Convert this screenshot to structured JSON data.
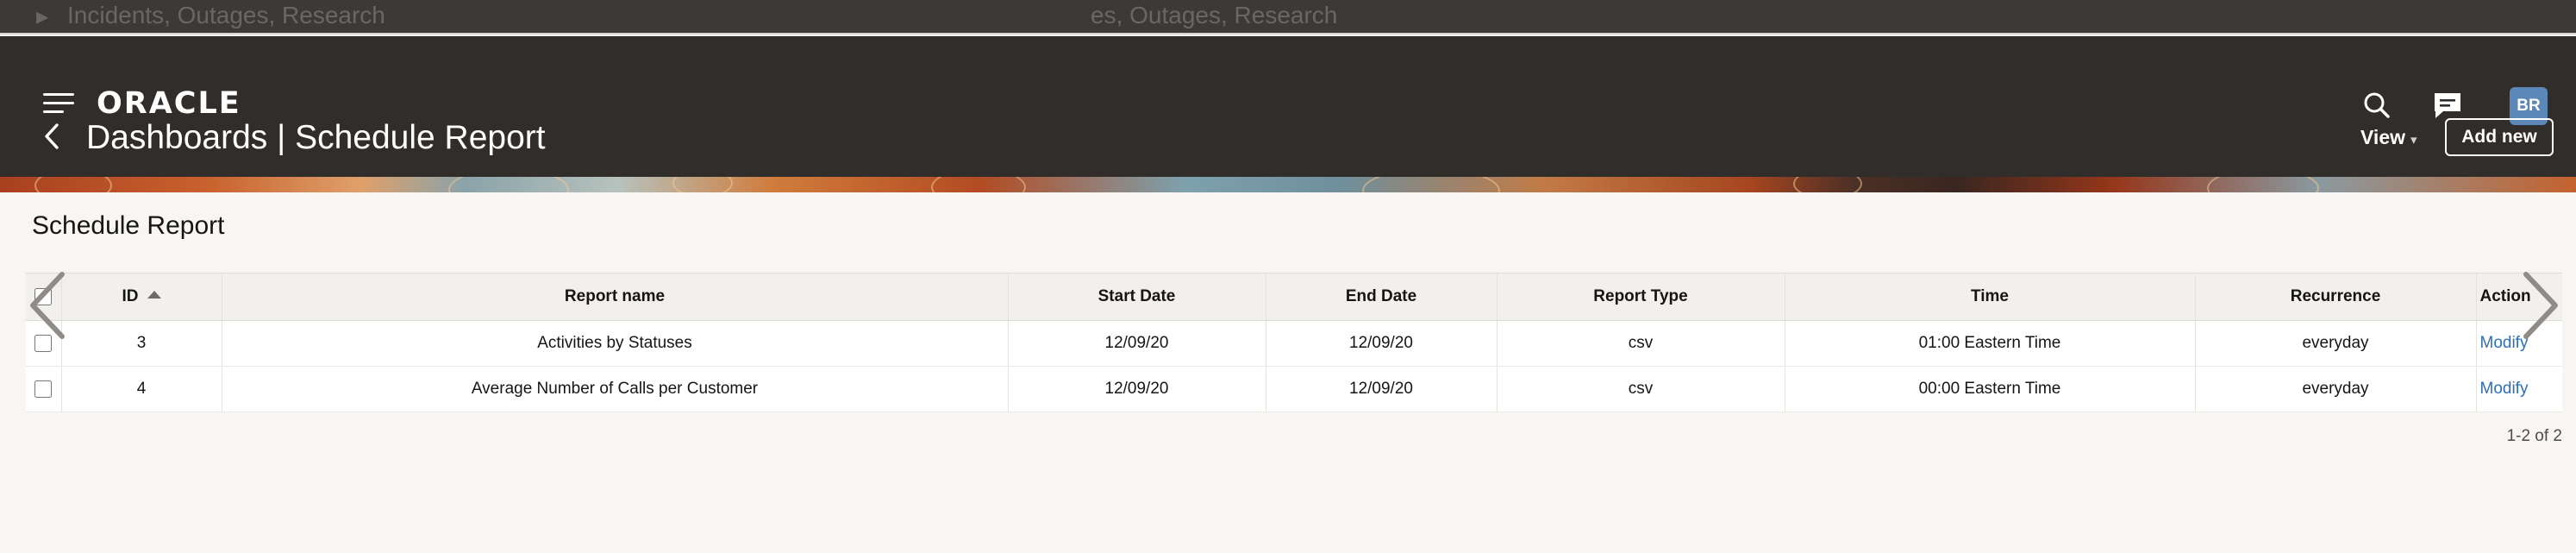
{
  "background_text": {
    "left": "Incidents, Outages, Research",
    "right": "es, Outages, Research"
  },
  "header": {
    "brand": "ORACLE",
    "avatar_initials": "BR",
    "title": "Dashboards | Schedule Report",
    "view_label": "View",
    "add_new_label": "Add new",
    "icons": [
      "menu-icon",
      "search-icon",
      "chat-icon",
      "back-chevron-icon",
      "chevron-down-icon"
    ]
  },
  "content": {
    "title": "Schedule Report"
  },
  "table": {
    "columns": [
      "ID",
      "Report name",
      "Start Date",
      "End Date",
      "Report Type",
      "Time",
      "Recurrence",
      "Action"
    ],
    "sort": {
      "column": "ID",
      "direction": "ascending"
    },
    "rows": [
      {
        "id": "3",
        "report_name": "Activities by Statuses",
        "start_date": "12/09/20",
        "end_date": "12/09/20",
        "report_type": "csv",
        "time": "01:00 Eastern Time",
        "recurrence": "everyday",
        "action": "Modify"
      },
      {
        "id": "4",
        "report_name": "Average Number of Calls per Customer",
        "start_date": "12/09/20",
        "end_date": "12/09/20",
        "report_type": "csv",
        "time": "00:00 Eastern Time",
        "recurrence": "everyday",
        "action": "Modify"
      }
    ]
  },
  "pagination": {
    "label": "1-2 of 2"
  },
  "colors": {
    "header_bg": "#312d2a",
    "page_bg": "#f7f6f2",
    "link": "#2f6fb5",
    "avatar_bg": "#5b88b8"
  }
}
